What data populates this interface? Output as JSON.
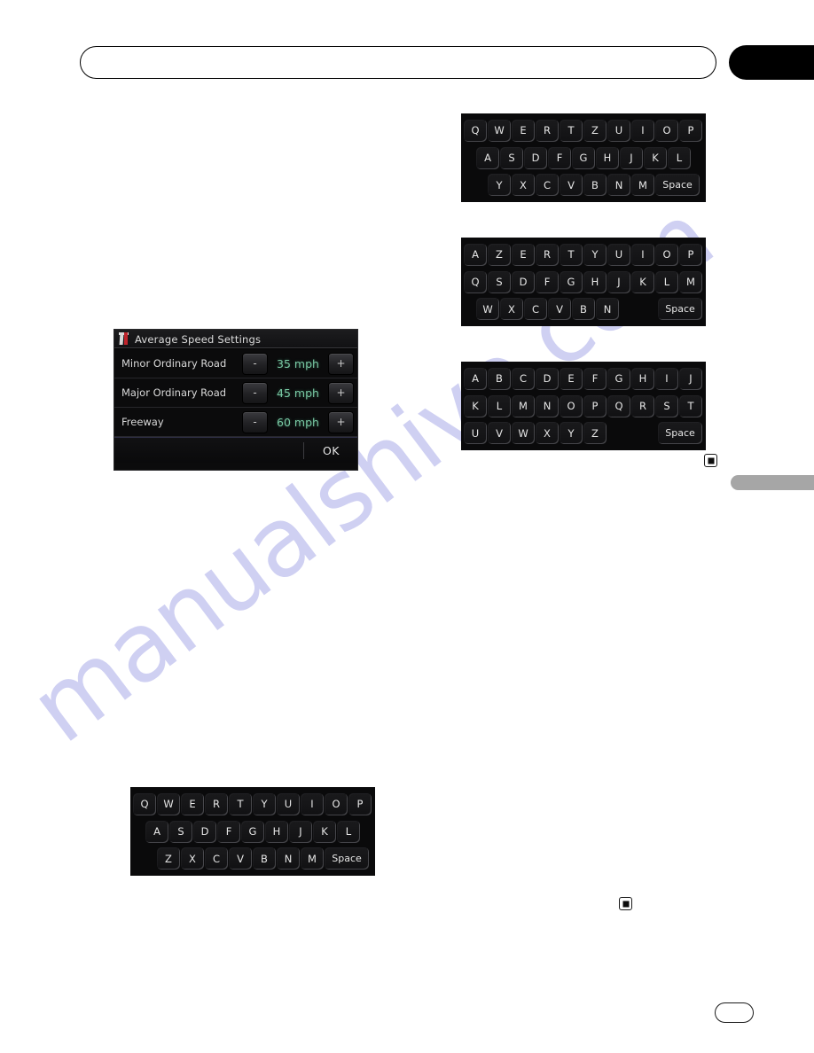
{
  "document": {
    "watermark": "manualshive.com"
  },
  "header": {
    "rule_label": "",
    "tab_label": ""
  },
  "side_tab": {
    "label": ""
  },
  "footer": {
    "page_number": ""
  },
  "markers": [
    {
      "name": "section-end-marker-right",
      "glyph": "■"
    },
    {
      "name": "section-end-marker-lower",
      "glyph": "■"
    }
  ],
  "settings_dialog": {
    "icon": "tool-icon",
    "title": "Average Speed Settings",
    "decrement_label": "-",
    "increment_label": "+",
    "rows": [
      {
        "label": "Minor Ordinary Road",
        "value": "35 mph"
      },
      {
        "label": "Major Ordinary Road",
        "value": "45 mph"
      },
      {
        "label": "Freeway",
        "value": "60 mph"
      }
    ],
    "ok_label": "OK",
    "value_color": "#79c9a4"
  },
  "keyboards": [
    {
      "name": "qwertz",
      "rows": [
        [
          "Q",
          "W",
          "E",
          "R",
          "T",
          "Z",
          "U",
          "I",
          "O",
          "P"
        ],
        [
          "A",
          "S",
          "D",
          "F",
          "G",
          "H",
          "J",
          "K",
          "L"
        ],
        [
          "Y",
          "X",
          "C",
          "V",
          "B",
          "N",
          "M",
          "Space"
        ]
      ]
    },
    {
      "name": "azerty",
      "rows": [
        [
          "A",
          "Z",
          "E",
          "R",
          "T",
          "Y",
          "U",
          "I",
          "O",
          "P"
        ],
        [
          "Q",
          "S",
          "D",
          "F",
          "G",
          "H",
          "J",
          "K",
          "L",
          "M"
        ],
        [
          "W",
          "X",
          "C",
          "V",
          "B",
          "N",
          "Space"
        ]
      ]
    },
    {
      "name": "abc",
      "rows": [
        [
          "A",
          "B",
          "C",
          "D",
          "E",
          "F",
          "G",
          "H",
          "I",
          "J"
        ],
        [
          "K",
          "L",
          "M",
          "N",
          "O",
          "P",
          "Q",
          "R",
          "S",
          "T"
        ],
        [
          "U",
          "V",
          "W",
          "X",
          "Y",
          "Z",
          "Space"
        ]
      ]
    },
    {
      "name": "qwerty",
      "rows": [
        [
          "Q",
          "W",
          "E",
          "R",
          "T",
          "Y",
          "U",
          "I",
          "O",
          "P"
        ],
        [
          "A",
          "S",
          "D",
          "F",
          "G",
          "H",
          "J",
          "K",
          "L"
        ],
        [
          "Z",
          "X",
          "C",
          "V",
          "B",
          "N",
          "M",
          "Space"
        ]
      ]
    }
  ]
}
